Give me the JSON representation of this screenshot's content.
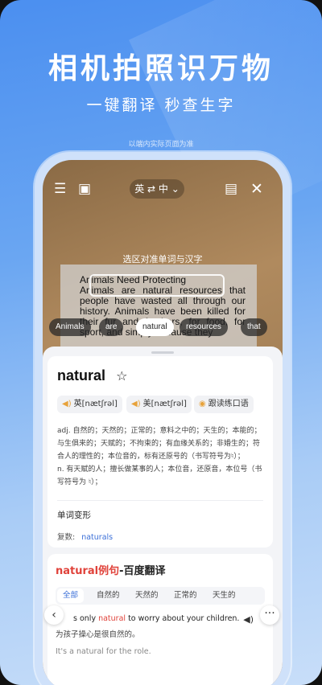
{
  "promo": {
    "headline": "相机拍照识万物",
    "subline": "一键翻译 秒查生字",
    "note": "以端内实际页面为准"
  },
  "camera": {
    "lang_switch": "英 ⇄ 中 ⌄",
    "hint": "选区对准单词与汉字",
    "paper_title": "Animals Need Protecting",
    "paper_text": "Animals are natural resources that people have wasted all through our history. Animals have been killed for their fur and feathers, for food, for sport, and simply because they",
    "chips": [
      "Animals",
      "are",
      "natural",
      "resources",
      "that"
    ],
    "active_chip": "natural"
  },
  "dictionary": {
    "word": "natural",
    "pron_uk": "英[nætʃrəl]",
    "pron_us": "美[nætʃrəl]",
    "practice": "跟读练口语",
    "def_adj": "adj. 自然的；天然的；正常的；意料之中的；天生的；本能的；与生俱来的；天赋的；不拘束的；有血缘关系的；非婚生的；符合人的理性的；本位音的，标有还原号的（书写符号为♮）；",
    "def_n": "n. 有天赋的人；擅长做某事的人；本位音，还原音，本位号（书写符号为 ♮）；",
    "inflection_title": "单词变形",
    "plural_label": "复数:",
    "plural_value": "naturals"
  },
  "examples": {
    "title_red": "natural例句",
    "title_dark": "-百度翻译",
    "tabs": [
      "全部",
      "自然的",
      "天然的",
      "正常的",
      "天生的"
    ],
    "sentence_pre": "s only ",
    "sentence_word": "natural",
    "sentence_post": " to worry about your children.",
    "translation": "为孩子操心是很自然的。",
    "next": "It's a natural for the role."
  }
}
